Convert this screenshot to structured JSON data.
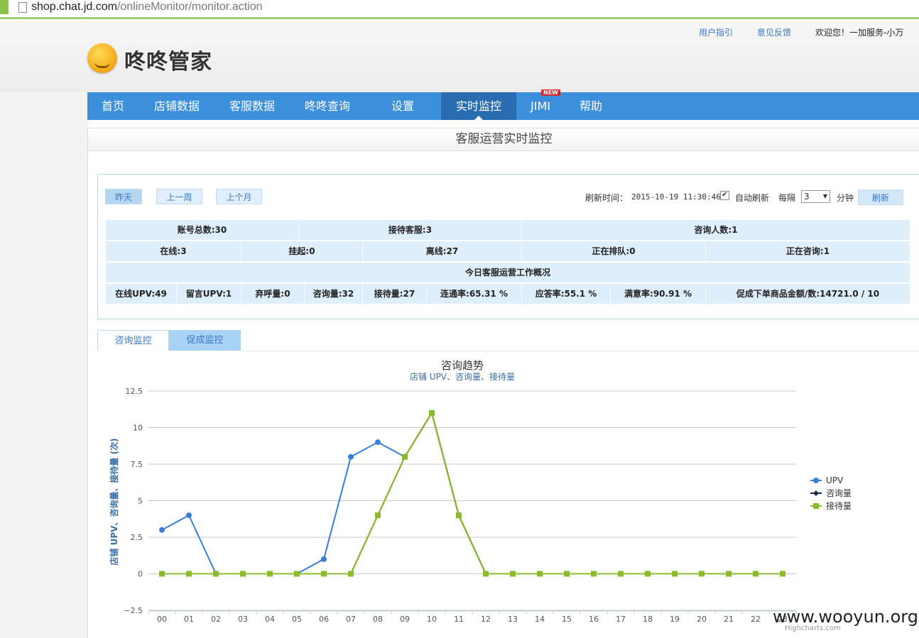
{
  "browser": {
    "url_host": "shop.chat.jd.com",
    "url_path": "/onlineMonitor/monitor.action"
  },
  "header": {
    "logo_text": "咚咚管家",
    "user_guide": "用户指引",
    "feedback": "意见反馈",
    "welcome": "欢迎您！一加服务-小万"
  },
  "nav": {
    "items": [
      "首页",
      "店铺数据",
      "客服数据",
      "咚咚查询",
      "设置",
      "实时监控",
      "JIMI",
      "帮助"
    ],
    "active": "实时监控",
    "new_badge": "NEW"
  },
  "panel": {
    "title": "客服运营实时监控"
  },
  "filters": {
    "yesterday": "昨天",
    "last_week": "上一周",
    "last_month": "上个月",
    "refresh_time_label": "刷新时间：",
    "refresh_time": "2015-10-19 11:30:46",
    "auto_refresh_label": "自动刷新",
    "auto_refresh_checked": true,
    "interval_label": "每隔",
    "interval_value": "3",
    "interval_unit": "分钟",
    "refresh_button": "刷新"
  },
  "stats": {
    "total_accounts": "账号总数:30",
    "receiving_cs": "接待客服:3",
    "consulting_people": "咨询人数:1",
    "online": "在线:3",
    "suspended": "挂起:0",
    "offline": "离线:27",
    "queuing": "正在排队:0",
    "consulting_now": "正在咨询:1",
    "today_title": "今日客服运营工作概况",
    "online_upv": "在线UPV:49",
    "message_upv": "留言UPV:1",
    "abandoned": "弃呼量:0",
    "consult_volume": "咨询量:32",
    "reception_volume": "接待量:27",
    "connect_rate": "连通率:65.31 %",
    "response_rate": "应答率:55.1 %",
    "satisfaction": "满意率:90.91 %",
    "promo_orders": "促成下单商品金额/数:14721.0 / 10"
  },
  "tabs": {
    "consult_monitor": "咨询监控",
    "promo_monitor": "促成监控"
  },
  "chart_data": {
    "type": "line",
    "title": "咨询趋势",
    "subtitle": "店铺 UPV、咨询量、接待量",
    "ylabel": "店铺 UPV、咨询量、接待量 (次)",
    "xlabel": "",
    "categories": [
      "00",
      "01",
      "02",
      "03",
      "04",
      "05",
      "06",
      "07",
      "08",
      "09",
      "10",
      "11",
      "12",
      "13",
      "14",
      "15",
      "16",
      "17",
      "18",
      "19",
      "20",
      "21",
      "22",
      "23"
    ],
    "ylim": [
      -2.5,
      12.5
    ],
    "yticks": [
      "12.5",
      "10",
      "7.5",
      "5",
      "2.5",
      "0",
      "-2.5"
    ],
    "grid": true,
    "legend_position": "right",
    "series": [
      {
        "name": "UPV",
        "color": "#3b7dd8",
        "marker": "circle",
        "values": [
          3,
          4,
          0,
          0,
          0,
          0,
          1,
          8,
          9,
          8,
          11,
          4,
          0,
          0,
          0,
          0,
          0,
          0,
          0,
          0,
          0,
          0,
          0,
          0
        ]
      },
      {
        "name": "咨询量",
        "color": "#1b2a4a",
        "marker": "diamond",
        "values": [
          0,
          0,
          0,
          0,
          0,
          0,
          0,
          0,
          4,
          8,
          11,
          4,
          0,
          0,
          0,
          0,
          0,
          0,
          0,
          0,
          0,
          0,
          0,
          0
        ]
      },
      {
        "name": "接待量",
        "color": "#8bbb2a",
        "marker": "square",
        "values": [
          0,
          0,
          0,
          0,
          0,
          0,
          0,
          0,
          4,
          8,
          11,
          4,
          0,
          0,
          0,
          0,
          0,
          0,
          0,
          0,
          0,
          0,
          0,
          0
        ]
      }
    ],
    "credits": "Highcharts.com"
  },
  "watermark": "www.wooyun.org"
}
